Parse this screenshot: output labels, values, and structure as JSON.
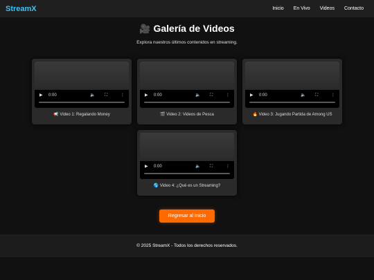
{
  "brand": "StreamX",
  "nav": [
    "Inicio",
    "En Vivo",
    "Videos",
    "Contacto"
  ],
  "page": {
    "title_icon": "🎥",
    "title": "Galería de Videos",
    "subtitle": "Explora nuestros últimos contenidos en streaming."
  },
  "videos": [
    {
      "time": "0:00",
      "caption": "📢 Video 1: Regalando Money"
    },
    {
      "time": "0:00",
      "caption": "🎬 Video 2: Videos de Pesca"
    },
    {
      "time": "0:00",
      "caption": "🔥 Video 3: Jugando Partida de Among US"
    },
    {
      "time": "0:00",
      "caption": "🌎 Video 4: ¿Qué es un Streaming?"
    }
  ],
  "icons": {
    "play": "▶",
    "volume": "🔈",
    "fullscreen": "⛶",
    "more": "⋮"
  },
  "home_button": "Regresar al Inicio",
  "footer": "© 2025 StreamX - Todos los derechos reservados.",
  "colors": {
    "brand": "#3ec1f3",
    "accent": "#ff6a00",
    "background": "#111111"
  }
}
